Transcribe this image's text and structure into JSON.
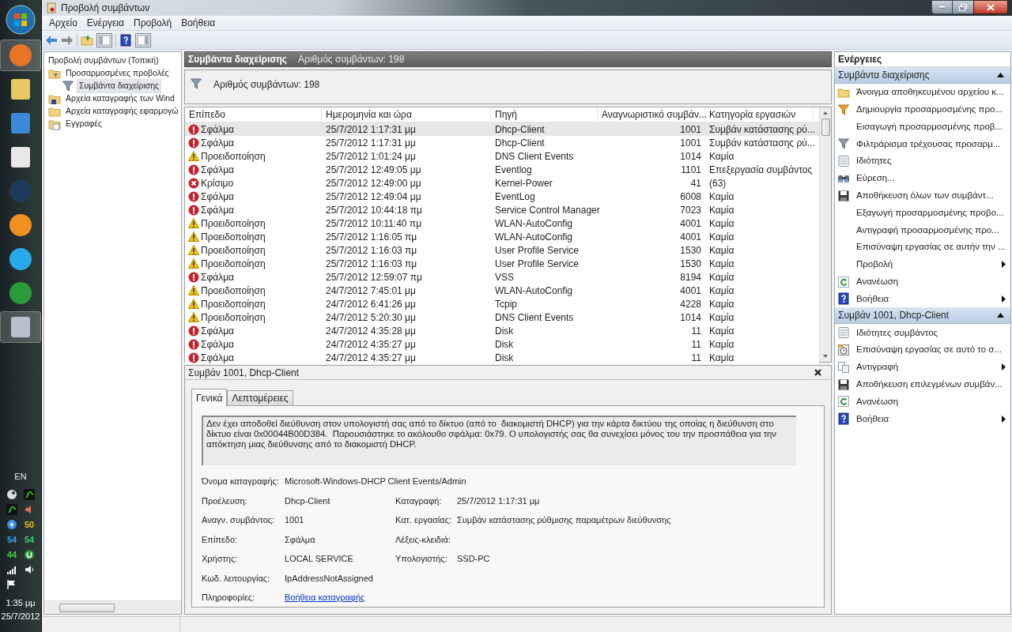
{
  "taskbar": {
    "language": "EN",
    "readings": [
      {
        "text": "50",
        "color": "#e8c020"
      },
      {
        "text": "54",
        "color": "#3aa0e8"
      },
      {
        "text": "54",
        "color": "#38d070"
      },
      {
        "text": "44",
        "color": "#40d040"
      }
    ],
    "time": "1:35 μμ",
    "date": "25/7/2012"
  },
  "window": {
    "title": "Προβολή συμβάντων"
  },
  "menu": [
    "Αρχείο",
    "Ενέργεια",
    "Προβολή",
    "Βοήθεια"
  ],
  "tree": [
    {
      "label": "Προβολή συμβάντων (Τοπική)",
      "selected": false,
      "children": [
        {
          "label": "Προσαρμοσμένες προβολές",
          "selected": false,
          "children": [
            {
              "label": "Συμβάντα διαχείρισης",
              "selected": true
            }
          ]
        },
        {
          "label": "Αρχεία καταγραφής των Wind",
          "selected": false
        },
        {
          "label": "Αρχεία καταγραφής εφαρμογώ",
          "selected": false
        },
        {
          "label": "Εγγραφές",
          "selected": false
        }
      ]
    }
  ],
  "center": {
    "title": "Συμβάντα διαχείρισης",
    "count_header": "Αριθμός συμβάντων: 198",
    "count_filter": "Αριθμός συμβάντων: 198"
  },
  "table": {
    "columns": [
      "Επίπεδο",
      "Ημερομηνία και ώρα",
      "Πηγή",
      "Αναγνωριστικό συμβάν...",
      "Κατηγορία εργασιών"
    ],
    "rows": [
      {
        "kind": "error",
        "level": "Σφάλμα",
        "date": "25/7/2012 1:17:31 μμ",
        "source": "Dhcp-Client",
        "id": "1001",
        "category": "Συμβάν κατάστασης ρύ...",
        "selected": true
      },
      {
        "kind": "error",
        "level": "Σφάλμα",
        "date": "25/7/2012 1:17:31 μμ",
        "source": "Dhcp-Client",
        "id": "1001",
        "category": "Συμβάν κατάστασης ρύ...",
        "selected": false
      },
      {
        "kind": "warning",
        "level": "Προειδοποίηση",
        "date": "25/7/2012 1:01:24 μμ",
        "source": "DNS Client Events",
        "id": "1014",
        "category": "Καμία",
        "selected": false
      },
      {
        "kind": "error",
        "level": "Σφάλμα",
        "date": "25/7/2012 12:49:05 μμ",
        "source": "Eventlog",
        "id": "1101",
        "category": "Επεξεργασία συμβάντος",
        "selected": false
      },
      {
        "kind": "critical",
        "level": "Κρίσιμο",
        "date": "25/7/2012 12:49:00 μμ",
        "source": "Kernel-Power",
        "id": "41",
        "category": "(63)",
        "selected": false
      },
      {
        "kind": "error",
        "level": "Σφάλμα",
        "date": "25/7/2012 12:49:04 μμ",
        "source": "EventLog",
        "id": "6008",
        "category": "Καμία",
        "selected": false
      },
      {
        "kind": "error",
        "level": "Σφάλμα",
        "date": "25/7/2012 10:44:18 πμ",
        "source": "Service Control Manager",
        "id": "7023",
        "category": "Καμία",
        "selected": false
      },
      {
        "kind": "warning",
        "level": "Προειδοποίηση",
        "date": "25/7/2012 10:11:40 πμ",
        "source": "WLAN-AutoConfig",
        "id": "4001",
        "category": "Καμία",
        "selected": false
      },
      {
        "kind": "warning",
        "level": "Προειδοποίηση",
        "date": "25/7/2012 1:16:05 πμ",
        "source": "WLAN-AutoConfig",
        "id": "4001",
        "category": "Καμία",
        "selected": false
      },
      {
        "kind": "warning",
        "level": "Προειδοποίηση",
        "date": "25/7/2012 1:16:03 πμ",
        "source": "User Profile Service",
        "id": "1530",
        "category": "Καμία",
        "selected": false
      },
      {
        "kind": "warning",
        "level": "Προειδοποίηση",
        "date": "25/7/2012 1:16:03 πμ",
        "source": "User Profile Service",
        "id": "1530",
        "category": "Καμία",
        "selected": false
      },
      {
        "kind": "error",
        "level": "Σφάλμα",
        "date": "25/7/2012 12:59:07 πμ",
        "source": "VSS",
        "id": "8194",
        "category": "Καμία",
        "selected": false
      },
      {
        "kind": "warning",
        "level": "Προειδοποίηση",
        "date": "24/7/2012 7:45:01 μμ",
        "source": "WLAN-AutoConfig",
        "id": "4001",
        "category": "Καμία",
        "selected": false
      },
      {
        "kind": "warning",
        "level": "Προειδοποίηση",
        "date": "24/7/2012 6:41:26 μμ",
        "source": "Tcpip",
        "id": "4228",
        "category": "Καμία",
        "selected": false
      },
      {
        "kind": "warning",
        "level": "Προειδοποίηση",
        "date": "24/7/2012 5:20:30 μμ",
        "source": "DNS Client Events",
        "id": "1014",
        "category": "Καμία",
        "selected": false
      },
      {
        "kind": "error",
        "level": "Σφάλμα",
        "date": "24/7/2012 4:35:28 μμ",
        "source": "Disk",
        "id": "11",
        "category": "Καμία",
        "selected": false
      },
      {
        "kind": "error",
        "level": "Σφάλμα",
        "date": "24/7/2012 4:35:27 μμ",
        "source": "Disk",
        "id": "11",
        "category": "Καμία",
        "selected": false
      },
      {
        "kind": "error",
        "level": "Σφάλμα",
        "date": "24/7/2012 4:35:27 μμ",
        "source": "Disk",
        "id": "11",
        "category": "Καμία",
        "selected": false
      }
    ]
  },
  "detail": {
    "title": "Συμβάν 1001, Dhcp-Client",
    "tabs": [
      {
        "label": "Γενικά",
        "selected": true
      },
      {
        "label": "Λεπτομέρειες",
        "selected": false
      }
    ],
    "description": "Δεν έχει αποδοθεί διεύθυνση στον υπολογιστή σας από το δίκτυο (από το  διακομιστή DHCP) για την κάρτα δικτύου της οποίας η διεύθυνση στο δίκτυο είναι 0x00044B00D384.  Παρουσιάστηκε το ακόλουθο σφάλμα: 0x79. Ο υπολογιστής σας θα συνεχίσει μόνος του την προσπάθεια για την απόκτηση μιας διεύθυνσης από το διακομιστή DHCP.",
    "log_name": {
      "label": "Όνομα καταγραφής:",
      "value": "Microsoft-Windows-DHCP Client Events/Admin"
    },
    "fields": [
      {
        "left": {
          "label": "Προέλευση:",
          "value": "Dhcp-Client"
        },
        "right": {
          "label": "Καταγραφή:",
          "value": "25/7/2012 1:17:31 μμ"
        }
      },
      {
        "left": {
          "label": "Αναγν. συμβάντος:",
          "value": "1001"
        },
        "right": {
          "label": "Κατ. εργασίας:",
          "value": "Συμβάν κατάστασης ρύθμισης παραμέτρων διεύθυνσης"
        }
      },
      {
        "left": {
          "label": "Επίπεδο:",
          "value": "Σφάλμα"
        },
        "right": {
          "label": "Λέξεις-κλειδιά:"
        }
      },
      {
        "left": {
          "label": "Χρήστης:",
          "value": "LOCAL SERVICE"
        },
        "right": {
          "label": "Υπολογιστής:",
          "value": "SSD-PC"
        }
      },
      {
        "left": {
          "label": "Κωδ. λειτουργίας:",
          "value": "IpAddressNotAssigned"
        }
      },
      {
        "left": {
          "label": "Πληροφορίες:",
          "value": "Βοήθεια καταγραφής",
          "kind": "link"
        }
      }
    ]
  },
  "actions": {
    "title": "Ενέργειες",
    "sections": [
      {
        "title": "Συμβάντα διαχείρισης",
        "expanded": true,
        "items": [
          {
            "label": "Άνοιγμα αποθηκευμένου αρχείου κ...",
            "submenu": false
          },
          {
            "label": "Δημιουργία προσαρμοσμένης προ...",
            "submenu": false
          },
          {
            "label": "Εισαγωγή προσαρμοσμένης προβ...",
            "submenu": false
          },
          {
            "label": "Φιλτράρισμα τρέχουσας προσαρμ...",
            "submenu": false
          },
          {
            "label": "Ιδιότητες",
            "submenu": false
          },
          {
            "label": "Εύρεση...",
            "submenu": false
          },
          {
            "label": "Αποθήκευση όλων των συμβάντ...",
            "submenu": false
          },
          {
            "label": "Εξαγωγή προσαρμοσμένης προβο...",
            "submenu": false
          },
          {
            "label": "Αντιγραφή προσαρμοσμένης προ...",
            "submenu": false
          },
          {
            "label": "Επισύναψη εργασίας σε αυτήν την ...",
            "submenu": false
          },
          {
            "label": "Προβολή",
            "submenu": true
          },
          {
            "label": "Ανανέωση",
            "submenu": false
          },
          {
            "label": "Βοήθεια",
            "submenu": true
          }
        ]
      },
      {
        "title": "Συμβάν 1001, Dhcp-Client",
        "expanded": true,
        "items": [
          {
            "label": "Ιδιότητες συμβάντος",
            "submenu": false
          },
          {
            "label": "Επισύναψη εργασίας σε αυτό το σ...",
            "submenu": false
          },
          {
            "label": "Αντιγραφή",
            "submenu": true
          },
          {
            "label": "Αποθήκευση επιλεγμένων συμβάν...",
            "submenu": false
          },
          {
            "label": "Ανανέωση",
            "submenu": false
          },
          {
            "label": "Βοήθεια",
            "submenu": true
          }
        ]
      }
    ]
  }
}
